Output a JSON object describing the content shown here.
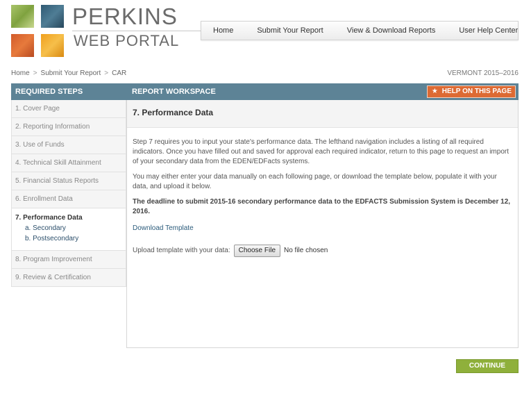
{
  "logo": {
    "line1": "PERKINS",
    "line2": "WEB PORTAL"
  },
  "nav": {
    "items": [
      {
        "label": "Home"
      },
      {
        "label": "Submit Your Report"
      },
      {
        "label": "View & Download Reports"
      },
      {
        "label": "User Help Center"
      }
    ]
  },
  "breadcrumb": {
    "items": [
      "Home",
      "Submit Your Report",
      "CAR"
    ],
    "separator": ">"
  },
  "state_year": "VERMONT 2015–2016",
  "sidebar": {
    "header": "REQUIRED STEPS",
    "steps": [
      {
        "label": "1. Cover Page"
      },
      {
        "label": "2. Reporting Information"
      },
      {
        "label": "3. Use of Funds"
      },
      {
        "label": "4. Technical Skill Attainment"
      },
      {
        "label": "5. Financial Status Reports"
      },
      {
        "label": "6. Enrollment Data"
      },
      {
        "label": "7. Performance Data",
        "active": true,
        "subitems": [
          "a. Secondary",
          "b. Postsecondary"
        ]
      },
      {
        "label": "8. Program Improvement"
      },
      {
        "label": "9. Review & Certification"
      }
    ]
  },
  "workspace": {
    "header": "REPORT WORKSPACE",
    "help_label": "HELP ON THIS PAGE",
    "title": "7. Performance Data",
    "para1": "Step 7 requires you to input your state's performance data. The lefthand navigation includes a listing of all required indicators. Once you have filled out and saved for approval each required indicator, return to this page to request an import of your secondary data from the EDEN/EDFacts systems.",
    "para2": "You may either enter your data manually on each following page, or download the template below, populate it with your data, and upload it below.",
    "deadline": "The deadline to submit 2015-16 secondary performance data to the EDFACTS Submission System is December 12, 2016.",
    "download_link": "Download Template",
    "upload_label": "Upload template with your data:",
    "choose_file": "Choose File",
    "no_file": "No file chosen"
  },
  "continue_label": "CONTINUE",
  "colors": {
    "header_bar": "#5d8396",
    "help_button": "#dd6a33",
    "continue_button": "#8fb03b",
    "link": "#2c5c7c"
  }
}
